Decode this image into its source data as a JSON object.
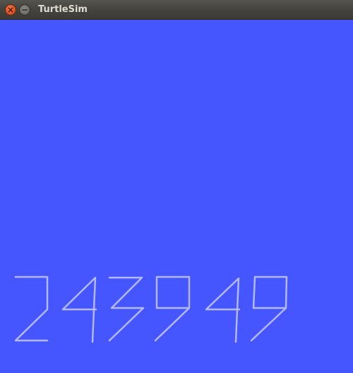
{
  "window": {
    "title": "TurtleSim",
    "close_icon": "close-icon",
    "minimize_icon": "minimize-icon"
  },
  "canvas": {
    "background_color": "#4556ff",
    "pen_color": "#b3b8ff",
    "drawn_digits": [
      "2",
      "4",
      "3",
      "9",
      "4",
      "9"
    ]
  }
}
